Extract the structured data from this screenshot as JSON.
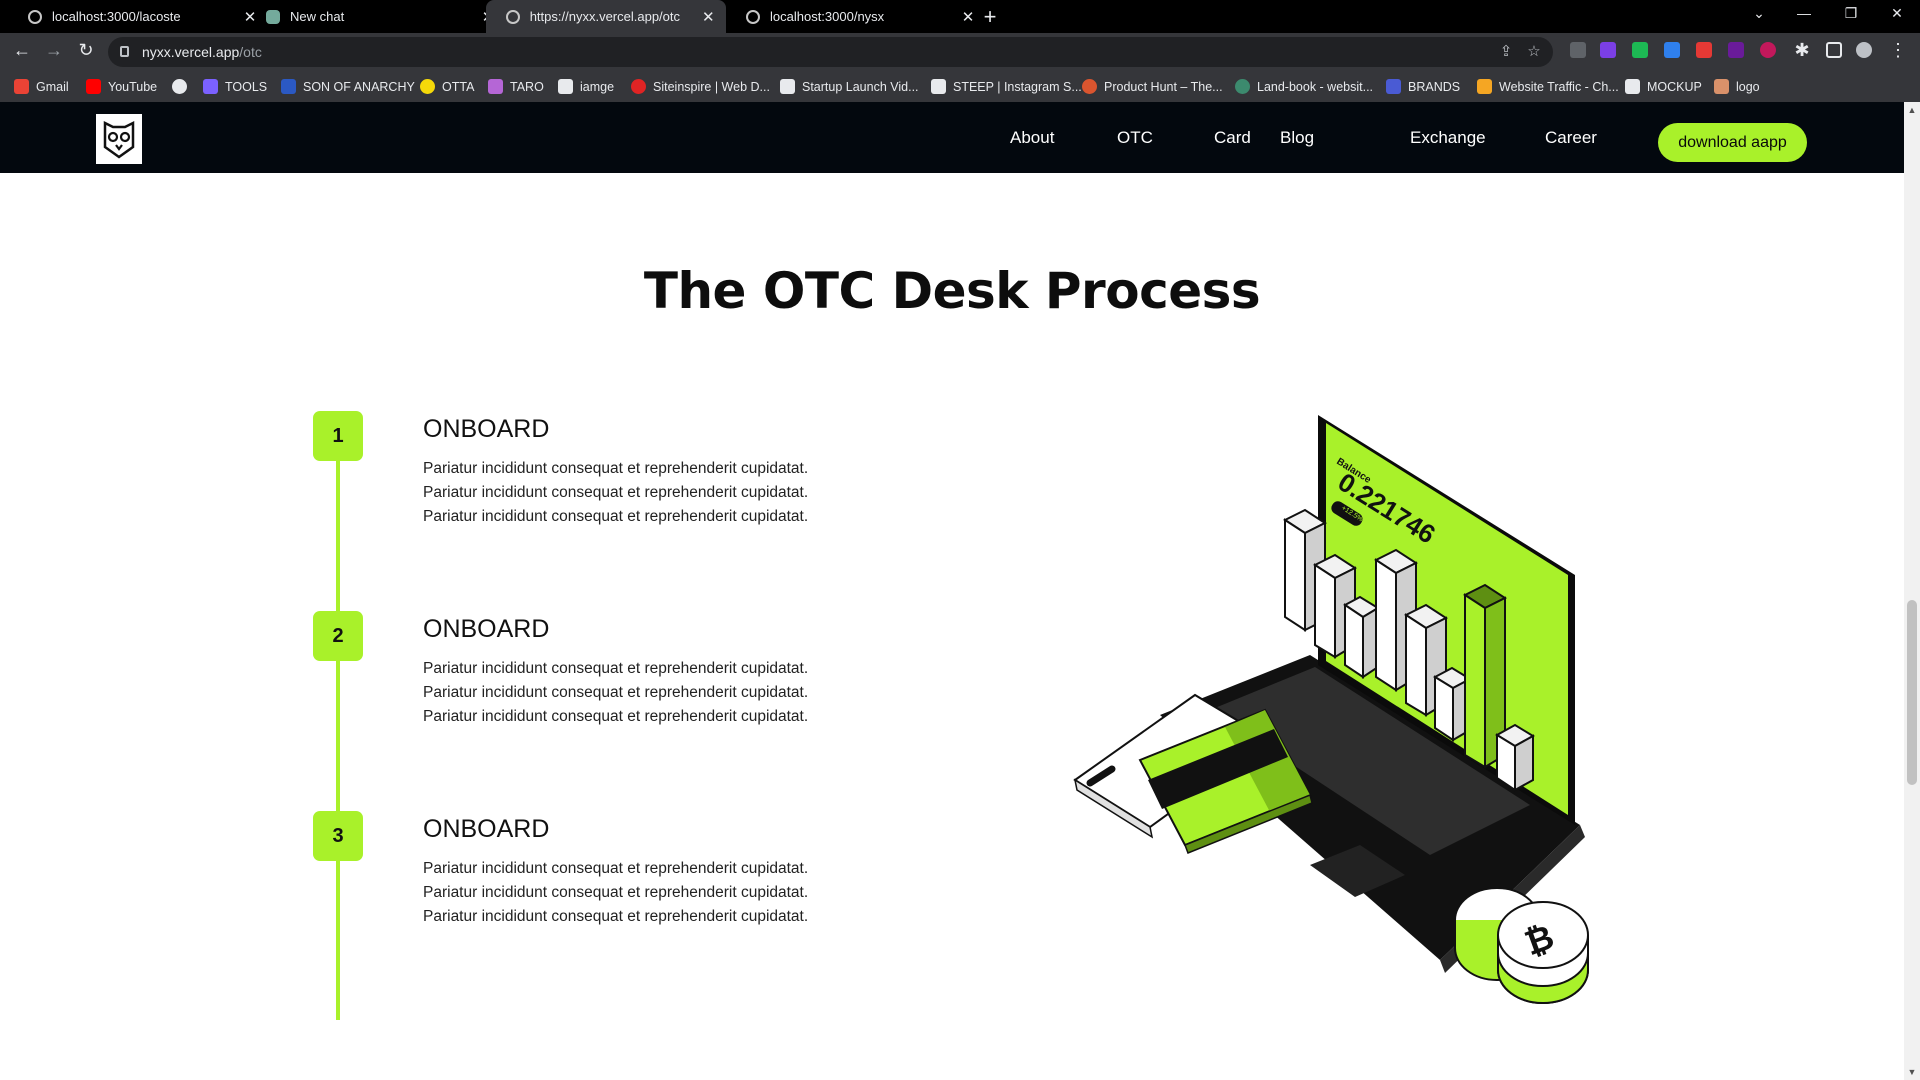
{
  "browser": {
    "tabs": [
      {
        "title": "localhost:3000/lacoste",
        "icon": "globe-icon",
        "active": false
      },
      {
        "title": "New chat",
        "icon": "chatgpt-icon",
        "active": false
      },
      {
        "title": "https://nyxx.vercel.app/otc",
        "icon": "globe-icon",
        "active": true
      },
      {
        "title": "localhost:3000/nysx",
        "icon": "globe-icon",
        "active": false
      }
    ],
    "address": {
      "host": "nyxx.vercel.app",
      "path": "/otc"
    },
    "bookmarks": [
      {
        "label": "Gmail",
        "color": "#ea4335"
      },
      {
        "label": "YouTube",
        "color": "#ff0000"
      },
      {
        "label": "",
        "color": "#e8eaed"
      },
      {
        "label": "TOOLS",
        "color": "#7b61ff"
      },
      {
        "label": "SON OF ANARCHY",
        "color": "#2b59c3"
      },
      {
        "label": "OTTA",
        "color": "#f5d90a"
      },
      {
        "label": "TARO",
        "color": "#b566d6"
      },
      {
        "label": "iamge",
        "color": "#e8eaed"
      },
      {
        "label": "Siteinspire | Web D...",
        "color": "#e02424"
      },
      {
        "label": "Startup Launch Vid...",
        "color": "#e8eaed"
      },
      {
        "label": "STEEP | Instagram S...",
        "color": "#e8eaed"
      },
      {
        "label": "Product Hunt – The...",
        "color": "#da552f"
      },
      {
        "label": "Land-book - websit...",
        "color": "#3c8a6e"
      },
      {
        "label": "BRANDS",
        "color": "#4a5bd4"
      },
      {
        "label": "Website Traffic - Ch...",
        "color": "#f5a623"
      },
      {
        "label": "MOCKUP",
        "color": "#e8eaed"
      },
      {
        "label": "logo",
        "color": "#d9916a"
      }
    ]
  },
  "site": {
    "nav": [
      "About",
      "OTC",
      "Card",
      "Blog",
      "Exchange",
      "Career"
    ],
    "cta": "download aapp",
    "accent": "#a9f12a",
    "header_bg": "#03080e"
  },
  "section": {
    "title": "The OTC Desk Process",
    "steps": [
      {
        "number": "1",
        "title": "ONBOARD",
        "lines": [
          "Pariatur incididunt consequat et reprehenderit cupidatat.",
          "Pariatur incididunt consequat et reprehenderit cupidatat.",
          "Pariatur incididunt consequat et reprehenderit cupidatat."
        ]
      },
      {
        "number": "2",
        "title": "ONBOARD",
        "lines": [
          "Pariatur incididunt consequat et reprehenderit cupidatat.",
          "Pariatur incididunt consequat et reprehenderit cupidatat.",
          "Pariatur incididunt consequat et reprehenderit cupidatat."
        ]
      },
      {
        "number": "3",
        "title": "ONBOARD",
        "lines": [
          "Pariatur incididunt consequat et reprehenderit cupidatat.",
          "Pariatur incididunt consequat et reprehenderit cupidatat.",
          "Pariatur incididunt consequat et reprehenderit cupidatat."
        ]
      }
    ]
  },
  "illustration": {
    "balance_label": "Balance",
    "balance_value": "0.221746",
    "balance_tag": "+12.5%"
  }
}
